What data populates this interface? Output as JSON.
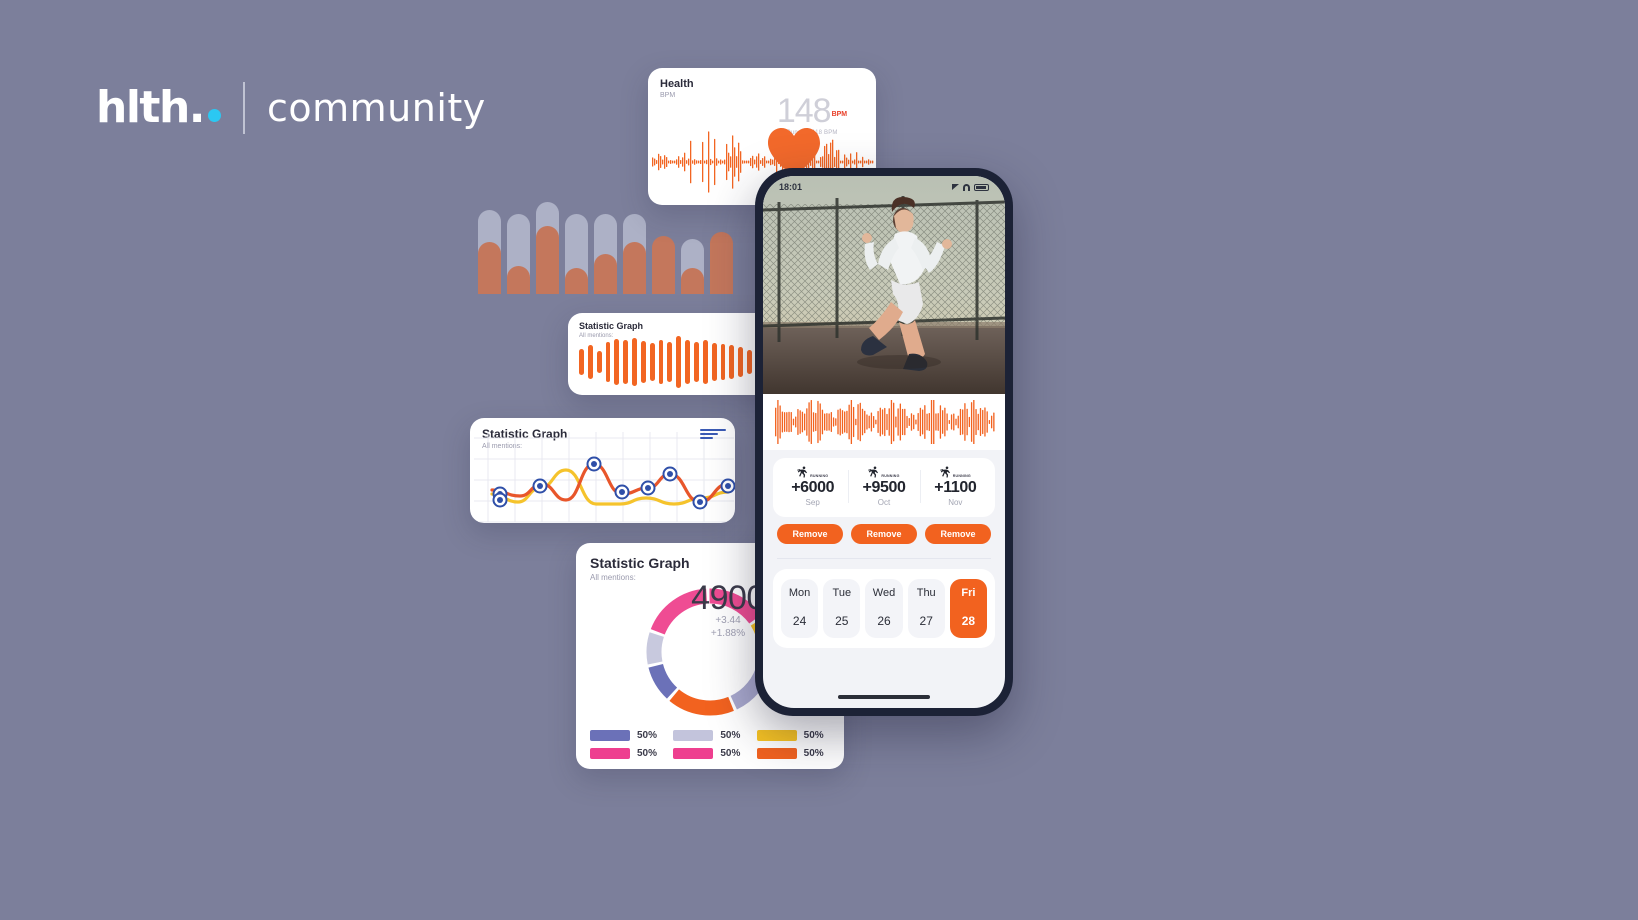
{
  "brand": {
    "name": "hlth.",
    "dot": "dot-icon",
    "divider": "vertical-divider",
    "suffix": "community",
    "dot_color": "#2bc8f2",
    "text_color": "#ffffff"
  },
  "background_color": "#7c7f9b",
  "accent_color": "#f2621f",
  "bar_backdrop": {
    "name": "bar-chart-backdrop",
    "track_color": "#adb1c6",
    "fill_color": "#c4775c",
    "tracks": [
      84,
      80,
      92,
      80,
      80,
      80,
      50,
      55,
      48
    ],
    "fills": [
      52,
      28,
      68,
      26,
      40,
      52,
      58,
      26,
      62
    ]
  },
  "health_card": {
    "title": "Health",
    "subtitle": "BPM",
    "value": "148",
    "unit": "BPM",
    "status": "Running 118 BPM",
    "value_color": "#cfcfd8",
    "unit_color": "#e8402a",
    "wave_color": "#f26522",
    "heart_color": "#f2692b"
  },
  "wavebar_card": {
    "title": "Statistic Graph",
    "subtitle": "All mentions:",
    "bar_color": "#f26522",
    "bars": [
      26,
      34,
      22,
      40,
      46,
      44,
      48,
      42,
      38,
      44,
      40,
      52,
      44,
      40,
      44,
      38,
      36,
      34,
      30,
      24,
      28,
      22,
      18,
      22,
      16
    ]
  },
  "line_card": {
    "title": "Statistic Graph",
    "subtitle": "All mentions:",
    "badge": "menu-lines-icon",
    "series_a_color": "#e8562b",
    "series_b_color": "#f5c32c",
    "marker_ring_color": "#2f4fa8",
    "marker_dot_color": "#2f4fa8",
    "grid_color": "#e8e9f0"
  },
  "donut_card": {
    "title": "Statistic Graph",
    "subtitle": "All mentions:",
    "center_value": "4900",
    "delta_abs": "+3.44",
    "delta_pct": "+1.88%",
    "segments": [
      {
        "name": "pink",
        "color": "#ef4c93",
        "value": 16
      },
      {
        "name": "yellow",
        "color": "#f8c423",
        "value": 13
      },
      {
        "name": "light-lavender",
        "color": "#a9a9ce",
        "value": 15
      },
      {
        "name": "orange",
        "color": "#f2621f",
        "value": 18
      },
      {
        "name": "indigo",
        "color": "#6b71b8",
        "value": 10
      },
      {
        "name": "pale-lilac",
        "color": "#c8c9de",
        "value": 9
      },
      {
        "name": "magenta",
        "color": "#ef4c93",
        "value": 19
      }
    ],
    "legend": [
      [
        {
          "color": "#6b71b8",
          "label": "50%"
        },
        {
          "color": "#c3c4dc",
          "label": "50%"
        },
        {
          "color": "#f8c423",
          "label": "50%"
        }
      ],
      [
        {
          "color": "#ee3f8f",
          "label": "50%"
        },
        {
          "color": "#ee3f8f",
          "label": "50%"
        },
        {
          "color": "#f2621f",
          "label": "50%"
        }
      ]
    ]
  },
  "phone": {
    "status": {
      "time": "18:01",
      "icons": [
        "signal-icon",
        "wifi-icon",
        "battery-icon"
      ]
    },
    "hero": {
      "name": "runner-photo",
      "alt": "Woman running on a bridge at sunset"
    },
    "waveform": {
      "name": "audio-waveform",
      "color": "#f2621f"
    },
    "stats": [
      {
        "activity": "RUNNING",
        "value": "+6000",
        "month": "Sep",
        "icon": "running-icon",
        "button": "Remove"
      },
      {
        "activity": "RUNNING",
        "value": "+9500",
        "month": "Oct",
        "icon": "running-icon",
        "button": "Remove"
      },
      {
        "activity": "RUNNING",
        "value": "+1100",
        "month": "Nov",
        "icon": "running-icon",
        "button": "Remove"
      }
    ],
    "calendar": [
      {
        "dow": "Mon",
        "date": "24",
        "active": false
      },
      {
        "dow": "Tue",
        "date": "25",
        "active": false
      },
      {
        "dow": "Wed",
        "date": "26",
        "active": false
      },
      {
        "dow": "Thu",
        "date": "27",
        "active": false
      },
      {
        "dow": "Fri",
        "date": "28",
        "active": true
      }
    ]
  }
}
